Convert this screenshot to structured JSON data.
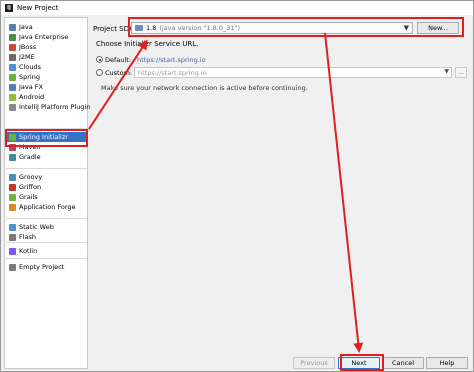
{
  "window": {
    "title": "New Project",
    "app_icon": "intellij-icon"
  },
  "sidebar": {
    "items": [
      {
        "label": "Java",
        "icon": "folder-icon",
        "color": "#5b7fb5"
      },
      {
        "label": "Java Enterprise",
        "icon": "enterprise-icon",
        "color": "#4a8b4a"
      },
      {
        "label": "JBoss",
        "icon": "jboss-icon",
        "color": "#c74b3b"
      },
      {
        "label": "J2ME",
        "icon": "j2me-icon",
        "color": "#6a6a6a"
      },
      {
        "label": "Clouds",
        "icon": "cloud-icon",
        "color": "#4e8fd1"
      },
      {
        "label": "Spring",
        "icon": "spring-icon",
        "color": "#6cb33f"
      },
      {
        "label": "Java FX",
        "icon": "javafx-icon",
        "color": "#5b7fb5"
      },
      {
        "label": "Android",
        "icon": "android-icon",
        "color": "#8cbf3f"
      },
      {
        "label": "IntelliJ Platform Plugin",
        "icon": "plugin-icon",
        "color": "#8a8a8a"
      },
      {
        "label": "Spring Initializr",
        "icon": "spring-initializr-icon",
        "color": "#6cb33f"
      },
      {
        "label": "Maven",
        "icon": "maven-icon",
        "color": "#b5465e"
      },
      {
        "label": "Gradle",
        "icon": "gradle-icon",
        "color": "#3d8f9a"
      },
      {
        "label": "Groovy",
        "icon": "groovy-icon",
        "color": "#4a8fb5"
      },
      {
        "label": "Griffon",
        "icon": "griffon-icon",
        "color": "#c0392b"
      },
      {
        "label": "Grails",
        "icon": "grails-icon",
        "color": "#6cb33f"
      },
      {
        "label": "Application Forge",
        "icon": "forge-icon",
        "color": "#d98a2b"
      },
      {
        "label": "Static Web",
        "icon": "web-icon",
        "color": "#4e8fd1"
      },
      {
        "label": "Flash",
        "icon": "flash-icon",
        "color": "#7a7a7a"
      },
      {
        "label": "Kotlin",
        "icon": "kotlin-icon",
        "color": "#7f52ff"
      },
      {
        "label": "Empty Project",
        "icon": "empty-project-icon",
        "color": "#7a7a7a"
      }
    ],
    "selected_index": 9
  },
  "sdk": {
    "label": "Project SDK:",
    "value": "1.8",
    "detail": "(java version \"1.8.0_31\")",
    "new_button": "New..."
  },
  "service": {
    "heading": "Choose Initializr Service URL.",
    "default_label": "Default:",
    "default_url": "https://start.spring.io",
    "custom_label": "Custom:",
    "custom_value": "https://start.spring.io",
    "note": "Make sure your network connection is active before continuing."
  },
  "footer": {
    "previous": "Previous",
    "next": "Next",
    "cancel": "Cancel",
    "help": "Help"
  },
  "annotation": {
    "color": "#e02020"
  }
}
